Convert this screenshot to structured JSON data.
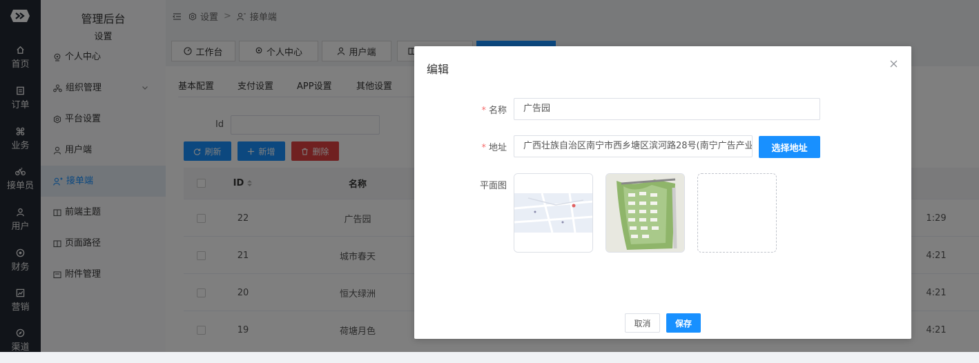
{
  "rail": {
    "items": [
      {
        "label": "首页",
        "icon": "home-icon"
      },
      {
        "label": "订单",
        "icon": "order-icon"
      },
      {
        "label": "业务",
        "icon": "command-icon"
      },
      {
        "label": "接单员",
        "icon": "bicycle-icon"
      },
      {
        "label": "用户",
        "icon": "user-icon"
      },
      {
        "label": "财务",
        "icon": "finance-icon"
      },
      {
        "label": "营销",
        "icon": "chart-icon"
      },
      {
        "label": "渠道",
        "icon": "compass-icon"
      }
    ]
  },
  "sidebar": {
    "title": "管理后台",
    "subtitle": "设置",
    "items": [
      {
        "label": "个人中心",
        "icon": "location-icon"
      },
      {
        "label": "组织管理",
        "icon": "org-icon"
      },
      {
        "label": "平台设置",
        "icon": "hexagon-icon"
      },
      {
        "label": "用户端",
        "icon": "user-icon"
      },
      {
        "label": "接单端",
        "icon": "user-switch-icon"
      },
      {
        "label": "前端主题",
        "icon": "book-icon"
      },
      {
        "label": "页面路径",
        "icon": "book-icon"
      },
      {
        "label": "附件管理",
        "icon": "folder-icon"
      }
    ]
  },
  "breadcrumb": {
    "root": "设置",
    "separator": ">",
    "current": "接单端"
  },
  "tabs": [
    {
      "label": "工作台"
    },
    {
      "label": "个人中心"
    },
    {
      "label": "用户端"
    }
  ],
  "config_tabs": [
    "基本配置",
    "支付设置",
    "APP设置",
    "其他设置"
  ],
  "search": {
    "id_label": "Id",
    "id_value": ""
  },
  "toolbar": {
    "refresh": "刷新",
    "add": "新增",
    "delete": "删除"
  },
  "table": {
    "headers": {
      "id": "ID",
      "name": "名称"
    },
    "rows": [
      {
        "id": "22",
        "name": "广告园",
        "time_tail": "1:29"
      },
      {
        "id": "21",
        "name": "城市春天",
        "time_tail": "4:21"
      },
      {
        "id": "20",
        "name": "恒大绿洲",
        "time_tail": "4:21"
      },
      {
        "id": "19",
        "name": "荷塘月色",
        "time_tail": "4:21"
      }
    ]
  },
  "modal": {
    "title": "编辑",
    "name_label": "名称",
    "name_value": "广告园",
    "address_label": "地址",
    "address_value": "广西壮族自治区南宁市西乡塘区滨河路28号(南宁广告产业",
    "pick_button": "选择地址",
    "plan_label": "平面图",
    "cancel": "取消",
    "save": "保存"
  },
  "colors": {
    "primary": "#1890ff",
    "danger": "#e04040",
    "rail_bg": "#222833",
    "required": "#f56c6c"
  }
}
